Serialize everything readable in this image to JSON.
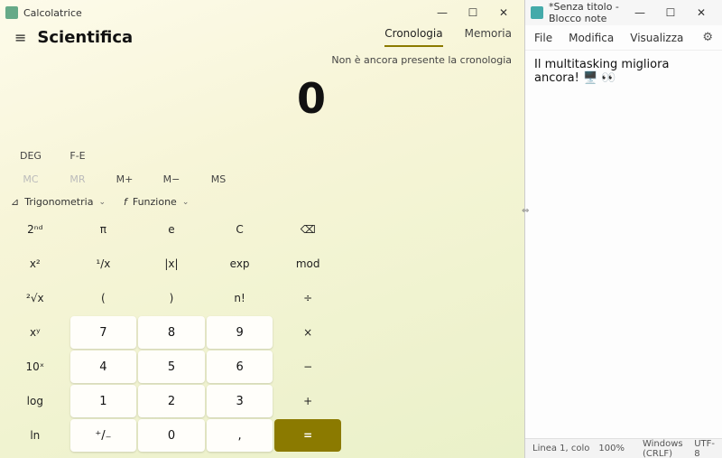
{
  "calculator": {
    "window_title": "Calcolatrice",
    "mode": "Scientifica",
    "tabs": {
      "history": "Cronologia",
      "memory": "Memoria",
      "active": "history"
    },
    "history_empty_text": "Non è ancora presente la cronologia",
    "display": "0",
    "deg_buttons": [
      "DEG",
      "F-E"
    ],
    "memory_buttons": [
      {
        "label": "MC",
        "enabled": false
      },
      {
        "label": "MR",
        "enabled": false
      },
      {
        "label": "M+",
        "enabled": true
      },
      {
        "label": "M−",
        "enabled": true
      },
      {
        "label": "MS",
        "enabled": true
      }
    ],
    "func_pills": {
      "trig": "Trigonometria",
      "func": "Funzione"
    },
    "keys": [
      [
        "2ⁿᵈ",
        "π",
        "e",
        "C",
        "⌫"
      ],
      [
        "x²",
        "¹/x",
        "|x|",
        "exp",
        "mod"
      ],
      [
        "²√x",
        "(",
        ")",
        "n!",
        "÷"
      ],
      [
        "xʸ",
        "7",
        "8",
        "9",
        "×"
      ],
      [
        "10ˣ",
        "4",
        "5",
        "6",
        "−"
      ],
      [
        "log",
        "1",
        "2",
        "3",
        "+"
      ],
      [
        "ln",
        "⁺/₋",
        "0",
        ",",
        "="
      ]
    ]
  },
  "notepad": {
    "window_title": "*Senza titolo - Blocco note",
    "menu": {
      "file": "File",
      "edit": "Modifica",
      "view": "Visualizza"
    },
    "content": "Il multitasking migliora ancora! 🖥️ 👀",
    "status": {
      "pos": "Linea 1, colo",
      "zoom": "100%",
      "eol": "Windows (CRLF)",
      "enc": "UTF-8"
    }
  },
  "window_controls": {
    "min": "—",
    "max": "☐",
    "close": "✕"
  }
}
